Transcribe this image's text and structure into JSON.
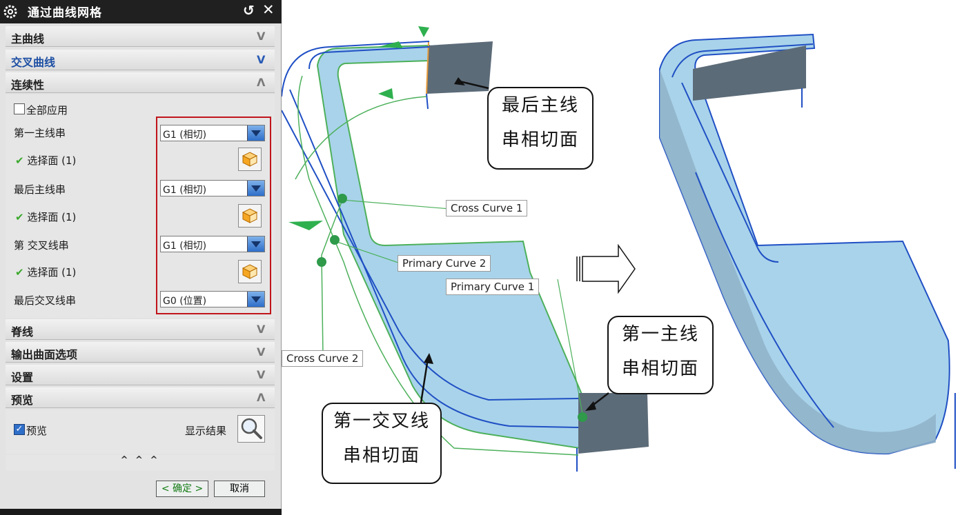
{
  "dialog": {
    "title": "通过曲线网格",
    "reset_icon": "↺",
    "close_icon": "✕",
    "sections": {
      "primary_curves": "主曲线",
      "cross_curves": "交叉曲线",
      "continuity": "连续性",
      "spine": "脊线",
      "output_surface_options": "输出曲面选项",
      "settings": "设置",
      "preview": "预览"
    },
    "chevrons": {
      "collapsed": "V",
      "expanded": "Λ"
    },
    "continuity": {
      "apply_all": "全部应用",
      "first_primary_label": "第一主线串",
      "first_primary_value": "G1 (相切)",
      "select_face_1": "选择面 (1)",
      "last_primary_label": "最后主线串",
      "last_primary_value": "G1 (相切)",
      "select_face_2": "选择面 (1)",
      "first_cross_label": "第  交叉线串",
      "first_cross_value": "G1 (相切)",
      "select_face_3": "选择面 (1)",
      "last_cross_label": "最后交叉线串",
      "last_cross_value": "G0 (位置)"
    },
    "preview": {
      "preview_label": "预览",
      "preview_checked": true,
      "show_result": "显示结果"
    },
    "expand_more": "^ ^ ^",
    "ok_button": "< 确定 >",
    "cancel_button": "取消"
  },
  "viewport": {
    "cross_curve_1": "Cross Curve  1",
    "cross_curve_2": "Cross Curve  2",
    "primary_curve_1": "Primary Curve  1",
    "primary_curve_2": "Primary Curve  2",
    "callout_last_primary": [
      "最后主线",
      "串相切面"
    ],
    "callout_first_primary": [
      "第一主线",
      "串相切面"
    ],
    "callout_first_cross": [
      "第一交叉线",
      "串相切面"
    ],
    "arrow_icon": "hollow-right-arrow"
  },
  "colors": {
    "surface": "#a9d3ea",
    "curve_blue": "#1f4fc4",
    "curve_green": "#4cb05a",
    "face_gray": "#5c6b78",
    "highlight_red": "#c0141a"
  }
}
